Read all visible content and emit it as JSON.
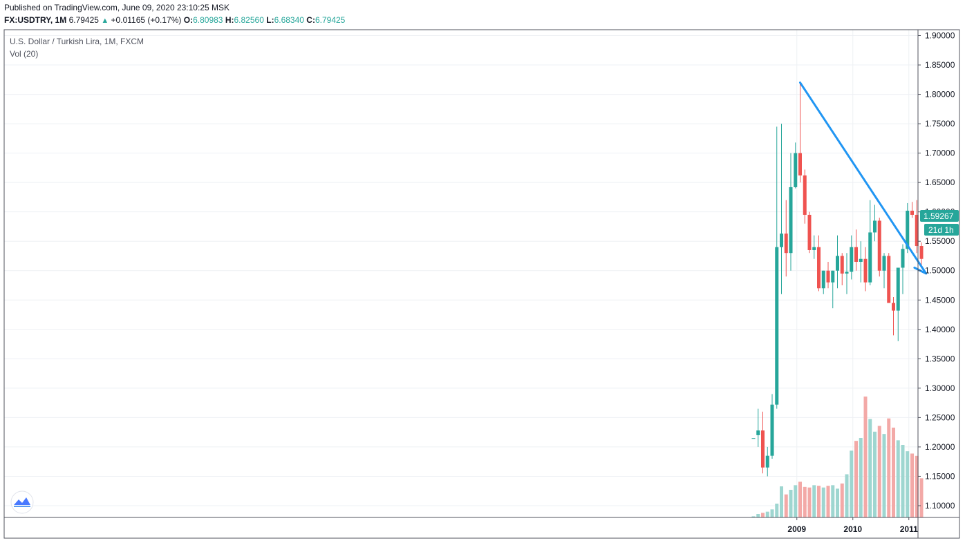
{
  "header": {
    "published": "Published on TradingView.com, June 09, 2020 23:10:25 MSK",
    "symbol": "FX:USDTRY, 1M",
    "last": "6.79425",
    "change_arrow": "▲",
    "change": "+0.01165 (+0.17%)",
    "o_label": "O:",
    "o_value": "6.80983",
    "h_label": "H:",
    "h_value": "6.82560",
    "l_label": "L:",
    "l_value": "6.68340",
    "c_label": "C:",
    "c_value": "6.79425"
  },
  "legend": {
    "title": "U.S. Dollar / Turkish Lira, 1M, FXCM",
    "volume": "Vol (20)"
  },
  "price_badge": {
    "price": "1.59267",
    "countdown": "21d 1h"
  },
  "colors": {
    "up": "#26a69a",
    "down": "#ef5350",
    "up_vol": "#9ed6d0",
    "down_vol": "#f3a9a7",
    "trendline": "#2196f3",
    "grid": "#eef0f4",
    "axis": "#50535e"
  },
  "logo_icon": "tradingview-logo-icon",
  "chart_data": {
    "type": "candlestick",
    "title": "U.S. Dollar / Turkish Lira, 1M, FXCM",
    "y_ticks": [
      "1.10000",
      "1.15000",
      "1.20000",
      "1.25000",
      "1.30000",
      "1.35000",
      "1.40000",
      "1.45000",
      "1.50000",
      "1.55000",
      "1.60000",
      "1.65000",
      "1.70000",
      "1.75000",
      "1.80000",
      "1.85000",
      "1.90000"
    ],
    "ylim": [
      1.08,
      1.91
    ],
    "x_ticks": [
      {
        "label": "2009",
        "index": 9
      },
      {
        "label": "2010",
        "index": 21
      },
      {
        "label": "2011",
        "index": 33
      }
    ],
    "grid": true,
    "candles": [
      {
        "o": 1.215,
        "h": 1.215,
        "l": 1.215,
        "c": 1.215
      },
      {
        "o": 1.22,
        "h": 1.265,
        "l": 1.2,
        "c": 1.228
      },
      {
        "o": 1.228,
        "h": 1.26,
        "l": 1.155,
        "c": 1.165
      },
      {
        "o": 1.165,
        "h": 1.2,
        "l": 1.15,
        "c": 1.185
      },
      {
        "o": 1.185,
        "h": 1.29,
        "l": 1.18,
        "c": 1.272
      },
      {
        "o": 1.272,
        "h": 1.745,
        "l": 1.265,
        "c": 1.54
      },
      {
        "o": 1.54,
        "h": 1.75,
        "l": 1.46,
        "c": 1.563
      },
      {
        "o": 1.563,
        "h": 1.62,
        "l": 1.49,
        "c": 1.53
      },
      {
        "o": 1.53,
        "h": 1.7,
        "l": 1.5,
        "c": 1.642
      },
      {
        "o": 1.642,
        "h": 1.718,
        "l": 1.64,
        "c": 1.7
      },
      {
        "o": 1.7,
        "h": 1.822,
        "l": 1.65,
        "c": 1.662
      },
      {
        "o": 1.662,
        "h": 1.672,
        "l": 1.58,
        "c": 1.595
      },
      {
        "o": 1.595,
        "h": 1.6,
        "l": 1.53,
        "c": 1.535
      },
      {
        "o": 1.535,
        "h": 1.56,
        "l": 1.52,
        "c": 1.54
      },
      {
        "o": 1.54,
        "h": 1.56,
        "l": 1.465,
        "c": 1.47
      },
      {
        "o": 1.47,
        "h": 1.5,
        "l": 1.46,
        "c": 1.5
      },
      {
        "o": 1.5,
        "h": 1.515,
        "l": 1.47,
        "c": 1.48
      },
      {
        "o": 1.48,
        "h": 1.5,
        "l": 1.436,
        "c": 1.5
      },
      {
        "o": 1.5,
        "h": 1.56,
        "l": 1.47,
        "c": 1.525
      },
      {
        "o": 1.525,
        "h": 1.53,
        "l": 1.475,
        "c": 1.495
      },
      {
        "o": 1.495,
        "h": 1.53,
        "l": 1.46,
        "c": 1.498
      },
      {
        "o": 1.498,
        "h": 1.56,
        "l": 1.485,
        "c": 1.54
      },
      {
        "o": 1.54,
        "h": 1.57,
        "l": 1.5,
        "c": 1.515
      },
      {
        "o": 1.515,
        "h": 1.55,
        "l": 1.48,
        "c": 1.52
      },
      {
        "o": 1.52,
        "h": 1.54,
        "l": 1.465,
        "c": 1.48
      },
      {
        "o": 1.48,
        "h": 1.62,
        "l": 1.475,
        "c": 1.565
      },
      {
        "o": 1.565,
        "h": 1.612,
        "l": 1.55,
        "c": 1.585
      },
      {
        "o": 1.585,
        "h": 1.59,
        "l": 1.49,
        "c": 1.5
      },
      {
        "o": 1.5,
        "h": 1.53,
        "l": 1.47,
        "c": 1.525
      },
      {
        "o": 1.525,
        "h": 1.53,
        "l": 1.455,
        "c": 1.445
      },
      {
        "o": 1.445,
        "h": 1.455,
        "l": 1.39,
        "c": 1.432
      },
      {
        "o": 1.432,
        "h": 1.505,
        "l": 1.38,
        "c": 1.505
      },
      {
        "o": 1.505,
        "h": 1.545,
        "l": 1.46,
        "c": 1.537
      },
      {
        "o": 1.537,
        "h": 1.615,
        "l": 1.53,
        "c": 1.602
      },
      {
        "o": 1.602,
        "h": 1.617,
        "l": 1.59,
        "c": 1.595
      },
      {
        "o": 1.595,
        "h": 1.62,
        "l": 1.53,
        "c": 1.542
      },
      {
        "o": 1.542,
        "h": 1.548,
        "l": 1.51,
        "c": 1.52
      }
    ],
    "volume": [
      0.2,
      0.6,
      0.8,
      1.0,
      1.4,
      2.4,
      5.4,
      4.0,
      4.8,
      5.6,
      6.2,
      5.3,
      5.2,
      5.6,
      5.5,
      5.2,
      5.5,
      5.6,
      5.0,
      5.9,
      7.5,
      11.6,
      13.3,
      13.8,
      21.0,
      17.1,
      14.9,
      15.9,
      14.5,
      17.2,
      15.6,
      13.4,
      12.6,
      11.5,
      11.1,
      10.7,
      6.8
    ],
    "trendline": [
      {
        "index": 10,
        "price": 1.82
      },
      {
        "index": 37,
        "price": 1.495
      },
      {
        "index": 34.5,
        "price": 1.505
      }
    ]
  }
}
